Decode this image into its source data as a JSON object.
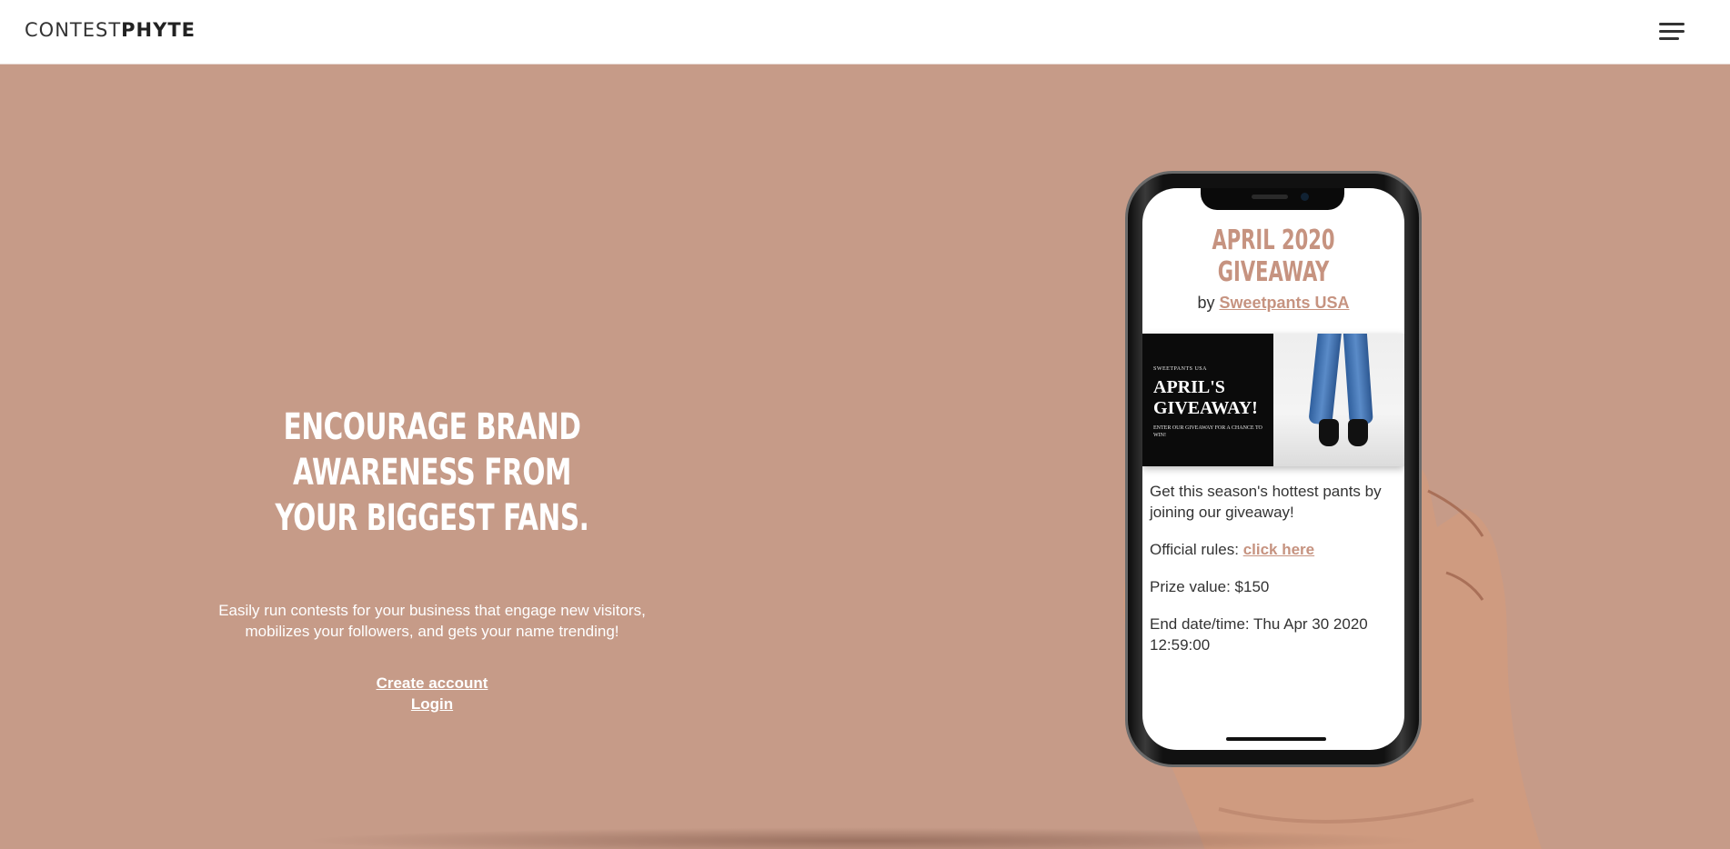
{
  "header": {
    "logo_light": "CONTEST",
    "logo_bold": "PHYTE",
    "menu_icon": "hamburger-icon"
  },
  "hero": {
    "title_line1": "ENCOURAGE BRAND AWARENESS FROM",
    "title_line2": "YOUR BIGGEST FANS.",
    "subtitle_line1": "Easily run contests for your business that engage new visitors,",
    "subtitle_line2": "mobilizes your followers, and gets your name trending!",
    "create_account": "Create account",
    "login": "Login"
  },
  "phone": {
    "title": "APRIL 2020 GIVEAWAY",
    "by": "by",
    "brand": "Sweetpants USA",
    "promo_small": "SWEETPANTS USA",
    "promo_big": "APRIL'S GIVEAWAY!",
    "promo_tiny": "ENTER OUR GIVEAWAY FOR A CHANCE TO WIN!",
    "desc": "Get this season's hottest pants by joining our giveaway!",
    "rules_label": "Official rules:",
    "rules_link": "click here",
    "prize": "Prize value: $150",
    "end_date": "End date/time: Thu Apr 30 2020 12:59:00"
  },
  "colors": {
    "background": "#c69b88",
    "accent": "#c69380",
    "header_bg": "#ffffff"
  }
}
